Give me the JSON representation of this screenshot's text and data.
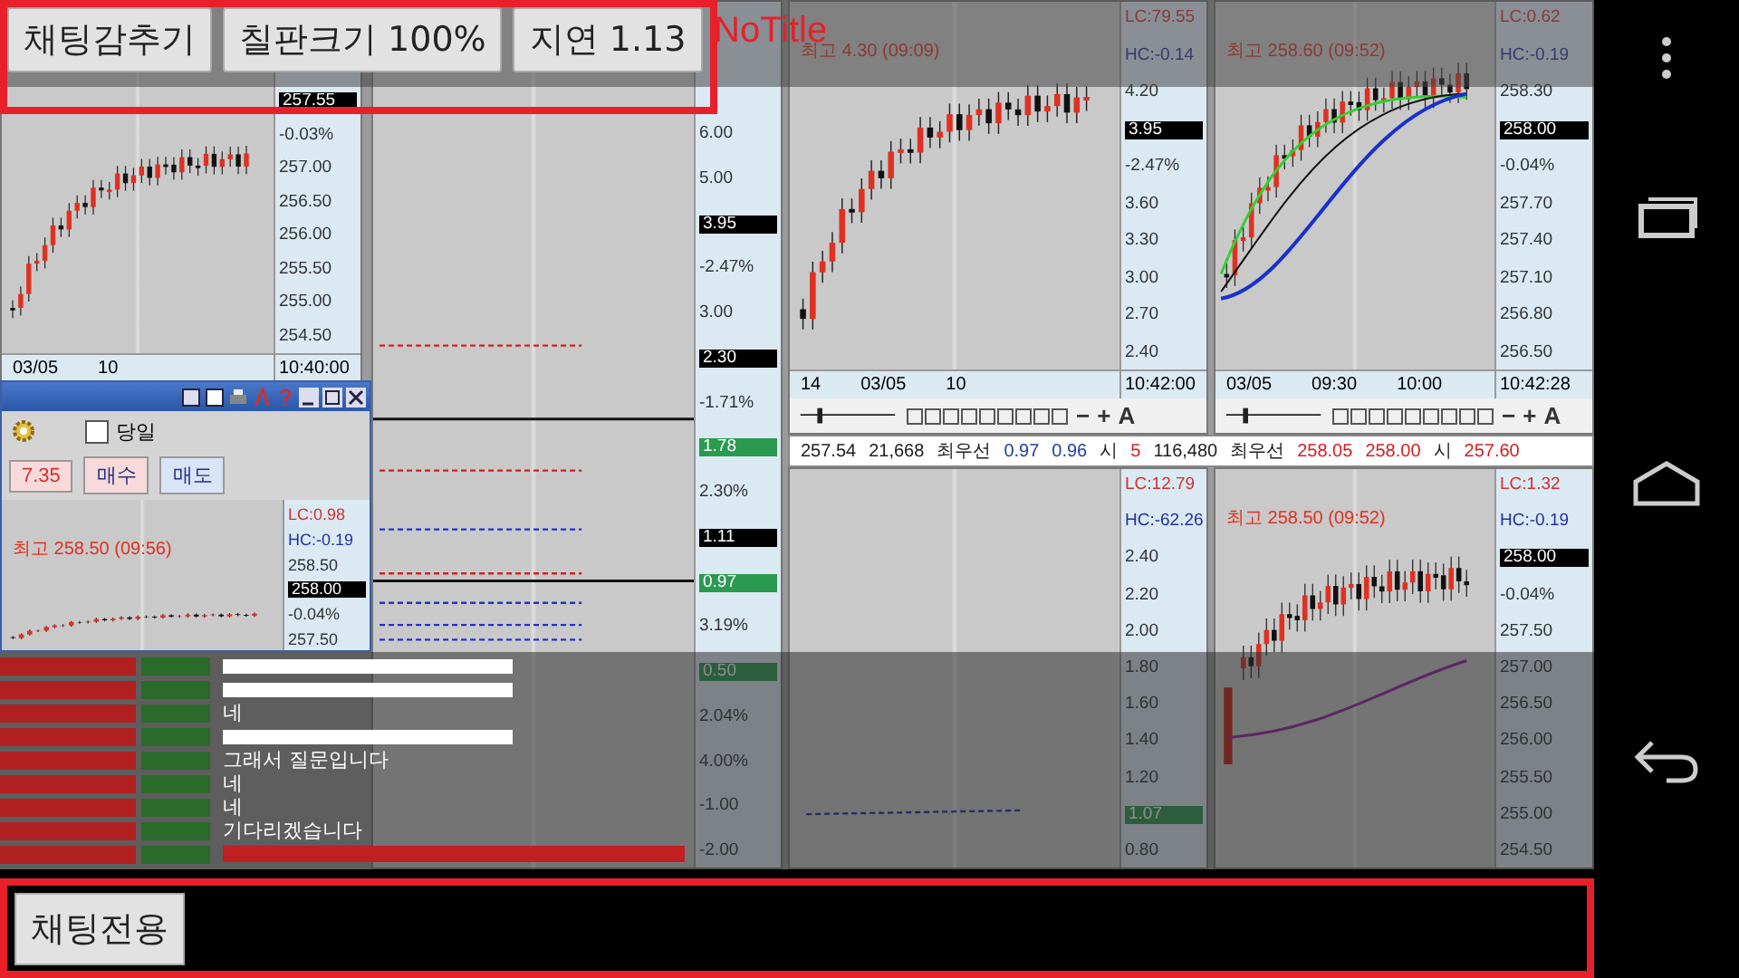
{
  "top_bar": {
    "buttons": [
      "채팅감추기",
      "칠판크기 100%",
      "지연 1.13"
    ],
    "title": "NoTitle"
  },
  "charts": [
    {
      "kind": "candle",
      "axis": [
        {
          "label": "257.55",
          "kind": "price"
        },
        {
          "label": "-0.03%",
          "kind": "change"
        },
        {
          "label": "257.00",
          "kind": "tick"
        },
        {
          "label": "256.50",
          "kind": "tick"
        },
        {
          "label": "256.00",
          "kind": "tick"
        },
        {
          "label": "255.50",
          "kind": "tick"
        },
        {
          "label": "255.00",
          "kind": "tick"
        },
        {
          "label": "254.50",
          "kind": "tick"
        }
      ],
      "time_labels": [
        "03/05",
        "10"
      ],
      "time": "10:40:00"
    },
    {
      "kind": "multi",
      "axis": [
        {
          "label": "6.00",
          "kind": "tick"
        },
        {
          "label": "5.00",
          "kind": "tick"
        },
        {
          "label": "3.95",
          "kind": "price"
        },
        {
          "label": "-2.47%",
          "kind": "change"
        },
        {
          "label": "3.00",
          "kind": "tick"
        },
        {
          "label": "2.30",
          "kind": "price"
        },
        {
          "label": "-1.71%",
          "kind": "change"
        },
        {
          "label": "1.78",
          "kind": "green"
        },
        {
          "label": "2.30%",
          "kind": "change"
        },
        {
          "label": "1.11",
          "kind": "price"
        },
        {
          "label": "0.97",
          "kind": "green"
        },
        {
          "label": "3.19%",
          "kind": "change"
        },
        {
          "label": "0.50",
          "kind": "green"
        },
        {
          "label": "2.04%",
          "kind": "change"
        },
        {
          "label": "4.00%",
          "kind": "change"
        },
        {
          "label": "-1.00",
          "kind": "tick"
        },
        {
          "label": "-2.00",
          "kind": "tick"
        }
      ]
    },
    {
      "kind": "candle",
      "note": "최고 4.30 (09:09)",
      "axis": [
        {
          "label": "LC:79.55",
          "kind": "lc"
        },
        {
          "label": "HC:-0.14",
          "kind": "hc"
        },
        {
          "label": "4.20",
          "kind": "tick"
        },
        {
          "label": "3.95",
          "kind": "price"
        },
        {
          "label": "-2.47%",
          "kind": "change"
        },
        {
          "label": "3.60",
          "kind": "tick"
        },
        {
          "label": "3.30",
          "kind": "tick"
        },
        {
          "label": "3.00",
          "kind": "tick"
        },
        {
          "label": "2.70",
          "kind": "tick"
        },
        {
          "label": "2.40",
          "kind": "tick"
        }
      ],
      "time_labels": [
        "14",
        "03/05",
        "10"
      ],
      "time": "10:42:00",
      "toolbar": [
        "−",
        "+",
        "A"
      ]
    },
    {
      "kind": "candle_ma",
      "note": "최고 258.60 (09:52)",
      "axis": [
        {
          "label": "LC:0.62",
          "kind": "lc"
        },
        {
          "label": "HC:-0.19",
          "kind": "hc"
        },
        {
          "label": "258.30",
          "kind": "tick"
        },
        {
          "label": "258.00",
          "kind": "price"
        },
        {
          "label": "-0.04%",
          "kind": "change"
        },
        {
          "label": "257.70",
          "kind": "tick"
        },
        {
          "label": "257.40",
          "kind": "tick"
        },
        {
          "label": "257.10",
          "kind": "tick"
        },
        {
          "label": "256.80",
          "kind": "tick"
        },
        {
          "label": "256.50",
          "kind": "tick"
        }
      ],
      "time_labels": [
        "03/05",
        "09:30",
        "10:00"
      ],
      "time": "10:42:28",
      "toolbar": [
        "−",
        "+",
        "A"
      ]
    },
    {
      "kind": "sparse",
      "axis": [
        {
          "label": "LC:12.79",
          "kind": "lc"
        },
        {
          "label": "HC:-62.26",
          "kind": "hc"
        },
        {
          "label": "2.40",
          "kind": "tick"
        },
        {
          "label": "2.20",
          "kind": "tick"
        },
        {
          "label": "2.00",
          "kind": "tick"
        },
        {
          "label": "1.80",
          "kind": "tick"
        },
        {
          "label": "1.60",
          "kind": "tick"
        },
        {
          "label": "1.40",
          "kind": "tick"
        },
        {
          "label": "1.20",
          "kind": "tick"
        },
        {
          "label": "1.07",
          "kind": "green"
        },
        {
          "label": "0.80",
          "kind": "tick"
        }
      ]
    },
    {
      "kind": "candle_line",
      "note": "최고 258.50 (09:52)",
      "axis": [
        {
          "label": "LC:1.32",
          "kind": "lc"
        },
        {
          "label": "HC:-0.19",
          "kind": "hc"
        },
        {
          "label": "258.00",
          "kind": "price"
        },
        {
          "label": "-0.04%",
          "kind": "change"
        },
        {
          "label": "257.50",
          "kind": "tick"
        },
        {
          "label": "257.00",
          "kind": "tick"
        },
        {
          "label": "256.50",
          "kind": "tick"
        },
        {
          "label": "256.00",
          "kind": "tick"
        },
        {
          "label": "255.50",
          "kind": "tick"
        },
        {
          "label": "255.00",
          "kind": "tick"
        },
        {
          "label": "254.50",
          "kind": "tick"
        }
      ]
    }
  ],
  "quote_row": [
    {
      "text": "257.54",
      "color": "#202020"
    },
    {
      "text": "21,668",
      "color": "#202020"
    },
    {
      "text": "최우선",
      "color": "#202020"
    },
    {
      "text": "0.97",
      "color": "#2040a0"
    },
    {
      "text": "0.96",
      "color": "#2040a0"
    },
    {
      "text": "시",
      "color": "#202020"
    },
    {
      "text": "5",
      "color": "#d02020"
    },
    {
      "text": "116,480",
      "color": "#202020"
    },
    {
      "text": "최우선",
      "color": "#202020"
    },
    {
      "text": "258.05",
      "color": "#d02020"
    },
    {
      "text": "258.00",
      "color": "#d02020"
    },
    {
      "text": "시",
      "color": "#202020"
    },
    {
      "text": "257.60",
      "color": "#d02020"
    }
  ],
  "order_window": {
    "checkbox": {
      "label": "당일",
      "checked": false
    },
    "buttons": [
      "7.35",
      "매수",
      "매도"
    ],
    "chart": {
      "kind": "candle",
      "note": "최고 258.50 (09:56)",
      "axis": [
        {
          "label": "LC:0.98",
          "kind": "lc"
        },
        {
          "label": "HC:-0.19",
          "kind": "hc"
        },
        {
          "label": "258.50",
          "kind": "tick"
        },
        {
          "label": "258.00",
          "kind": "price"
        },
        {
          "label": "-0.04%",
          "kind": "change"
        },
        {
          "label": "257.50",
          "kind": "tick"
        }
      ]
    }
  },
  "chat": [
    {
      "kind": "redacted"
    },
    {
      "kind": "redacted"
    },
    {
      "kind": "text",
      "text": "네"
    },
    {
      "kind": "redacted"
    },
    {
      "kind": "text",
      "text": "그래서 질문입니다"
    },
    {
      "kind": "text",
      "text": "네"
    },
    {
      "kind": "text",
      "text": "네"
    },
    {
      "kind": "text",
      "text": "기다리겠습니다"
    },
    {
      "kind": "notice"
    }
  ],
  "chat_bar": {
    "button": "채팅전용"
  }
}
